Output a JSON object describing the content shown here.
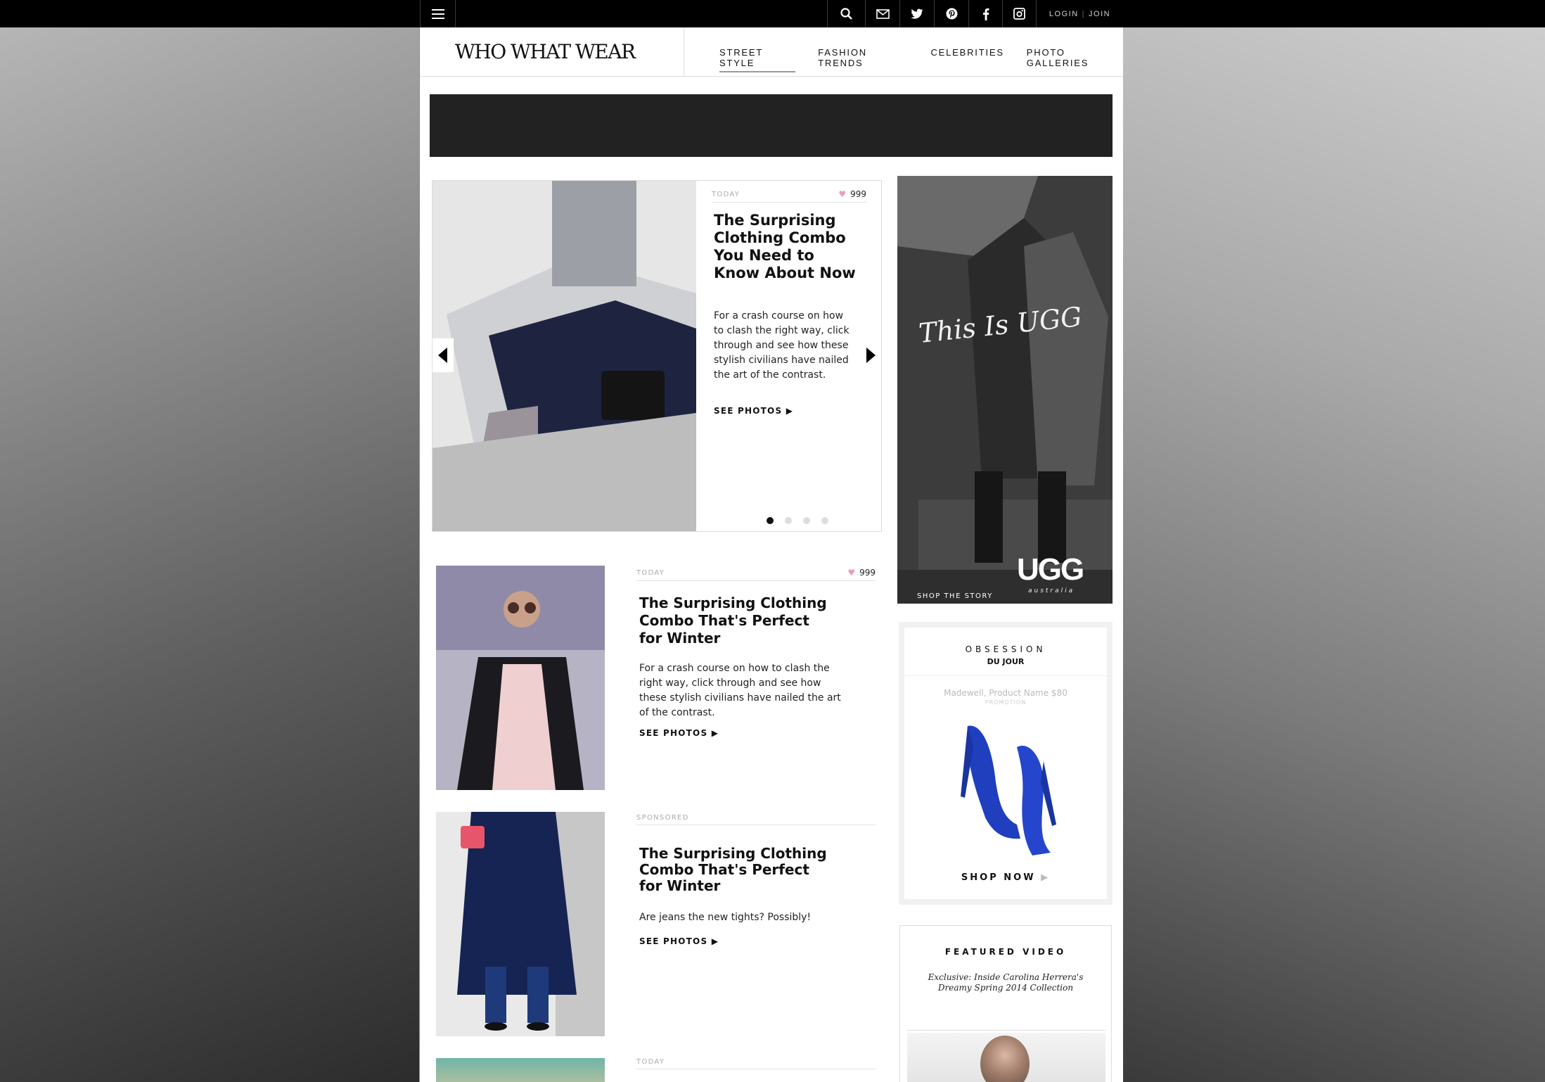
{
  "site": {
    "logo": "WHO WHAT WEAR",
    "nav": [
      "STREET STYLE",
      "FASHION TRENDS",
      "CELEBRITIES",
      "PHOTO GALLERIES"
    ],
    "active_nav_index": 0
  },
  "topbar": {
    "icons": [
      "menu-icon",
      "search-icon",
      "mail-icon",
      "twitter-icon",
      "pinterest-icon",
      "facebook-icon",
      "instagram-icon"
    ],
    "login": "LOGIN",
    "join": "JOIN",
    "separator": "|"
  },
  "hero": {
    "date": "TODAY",
    "likes": "999",
    "title": "The Surprising Clothing Combo You Need to Know About Now",
    "body": "For a crash course on how to clash the right way, click through and see how these stylish civilians have nailed the art of the contrast.",
    "cta": "SEE PHOTOS",
    "slide_count": 4,
    "active_slide": 0
  },
  "articles": [
    {
      "date": "TODAY",
      "likes": "999",
      "title": "The Surprising Clothing Combo That's Perfect for Winter",
      "body": "For a crash course on how to clash the right way, click through and see how these stylish civilians have nailed the art of the contrast.",
      "cta": "SEE PHOTOS"
    },
    {
      "date": "SPONSORED",
      "title": "The Surprising Clothing Combo That's Perfect for Winter",
      "body": "Are jeans the new tights? Possibly!",
      "cta": "SEE PHOTOS"
    },
    {
      "date": "TODAY"
    }
  ],
  "ugg_ad": {
    "script": "This Is UGG",
    "logo": "UGG",
    "sub": "australia",
    "cta": "SHOP THE STORY"
  },
  "obsession": {
    "title": "OBSESSION",
    "subtitle": "DU JOUR",
    "product": "Madewell, Product Name $80",
    "promo": "PROMOTION",
    "cta": "SHOP NOW"
  },
  "featured_video": {
    "title": "FEATURED VIDEO",
    "description": "Exclusive: Inside Carolina Herrera's Dreamy Spring 2014 Collection"
  },
  "colors": {
    "topbar": "#000000",
    "ad_banner": "#222222",
    "heart": "#e8a0b0",
    "shoe": "#1f3fbf"
  }
}
